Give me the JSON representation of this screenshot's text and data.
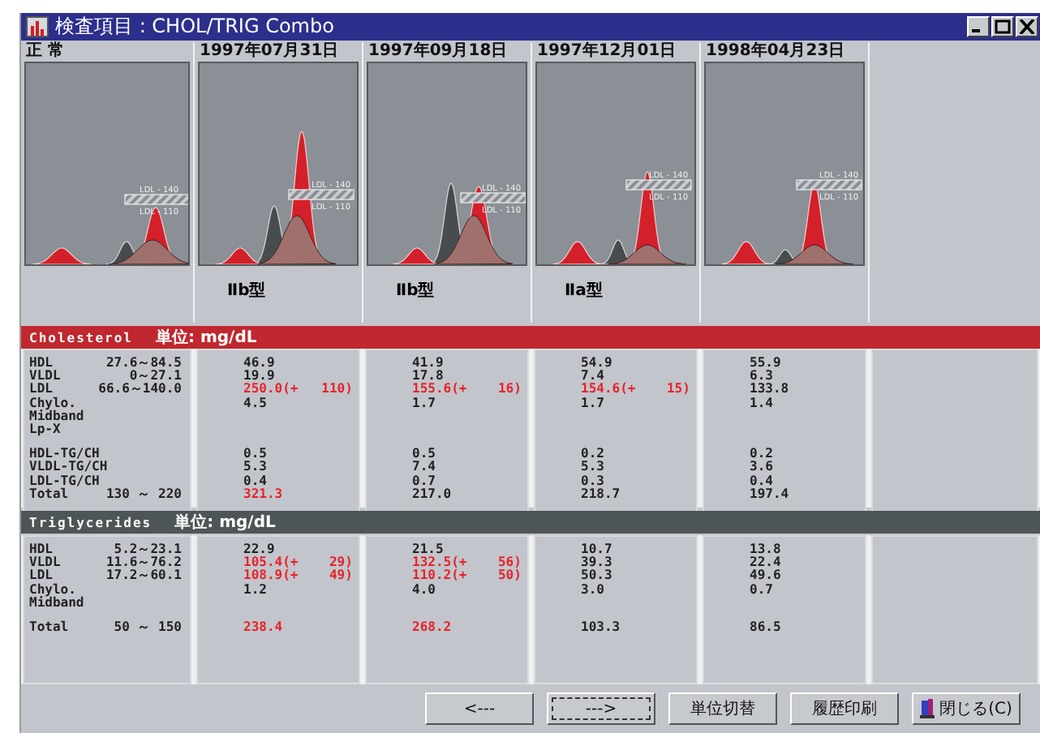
{
  "window": {
    "title": "検査項目 : CHOL/TRIG Combo"
  },
  "columns": [
    {
      "header": "正 常",
      "thresholds": [
        "LDL - 140",
        "LDL - 110"
      ]
    },
    {
      "header": "1997年07月31日",
      "thresholds": [
        "LDL - 140",
        "LDL - 110"
      ],
      "type_label": "Ⅱb型"
    },
    {
      "header": "1997年09月18日",
      "thresholds": [
        "LDL - 140",
        "LDL - 110"
      ],
      "type_label": "Ⅱb型"
    },
    {
      "header": "1997年12月01日",
      "thresholds": [
        "LDL - 140",
        "LDL - 110"
      ],
      "type_label": "Ⅱa型"
    },
    {
      "header": "1998年04月23日",
      "thresholds": [
        "LDL - 140",
        "LDL - 110"
      ]
    }
  ],
  "sections": [
    {
      "kind": "cholesterol",
      "title": "Cholesterol",
      "unit": "単位: mg/dL",
      "groups": [
        [
          {
            "label": "HDL",
            "range": "27.6～84.5",
            "values": [
              {
                "text": "46.9",
                "high": false
              },
              {
                "text": "41.9",
                "high": false
              },
              {
                "text": "54.9",
                "high": false
              },
              {
                "text": "55.9",
                "high": false
              }
            ]
          },
          {
            "label": "VLDL",
            "range": "0～27.1",
            "values": [
              {
                "text": "19.9",
                "high": false
              },
              {
                "text": "17.8",
                "high": false
              },
              {
                "text": "7.4",
                "high": false
              },
              {
                "text": "6.3",
                "high": false
              }
            ]
          },
          {
            "label": "LDL",
            "range": "66.6～140.0",
            "values": [
              {
                "text": "250.0(+   110)",
                "high": true
              },
              {
                "text": "155.6(+    16)",
                "high": true
              },
              {
                "text": "154.6(+    15)",
                "high": true
              },
              {
                "text": "133.8",
                "high": false
              }
            ]
          },
          {
            "label": "Chylo.",
            "values": [
              {
                "text": "4.5",
                "high": false
              },
              {
                "text": "1.7",
                "high": false
              },
              {
                "text": "1.7",
                "high": false
              },
              {
                "text": "1.4",
                "high": false
              }
            ]
          },
          {
            "label": "Midband"
          },
          {
            "label": "Lp-X"
          }
        ],
        [
          {
            "label": "HDL-TG/CH",
            "values": [
              {
                "text": "0.5",
                "high": false
              },
              {
                "text": "0.5",
                "high": false
              },
              {
                "text": "0.2",
                "high": false
              },
              {
                "text": "0.2",
                "high": false
              }
            ]
          },
          {
            "label": "VLDL-TG/CH",
            "values": [
              {
                "text": "5.3",
                "high": false
              },
              {
                "text": "7.4",
                "high": false
              },
              {
                "text": "5.3",
                "high": false
              },
              {
                "text": "3.6",
                "high": false
              }
            ]
          },
          {
            "label": "LDL-TG/CH",
            "values": [
              {
                "text": "0.4",
                "high": false
              },
              {
                "text": "0.7",
                "high": false
              },
              {
                "text": "0.3",
                "high": false
              },
              {
                "text": "0.4",
                "high": false
              }
            ]
          },
          {
            "label": "Total",
            "range": "130 ～ 220",
            "values": [
              {
                "text": "321.3",
                "high": true
              },
              {
                "text": "217.0",
                "high": false
              },
              {
                "text": "218.7",
                "high": false
              },
              {
                "text": "197.4",
                "high": false
              }
            ]
          }
        ]
      ]
    },
    {
      "kind": "triglycerides",
      "title": "Triglycerides",
      "unit": "単位: mg/dL",
      "groups": [
        [
          {
            "label": "HDL",
            "range": "5.2～23.1",
            "values": [
              {
                "text": "22.9",
                "high": false
              },
              {
                "text": "21.5",
                "high": false
              },
              {
                "text": "10.7",
                "high": false
              },
              {
                "text": "13.8",
                "high": false
              }
            ]
          },
          {
            "label": "VLDL",
            "range": "11.6～76.2",
            "values": [
              {
                "text": "105.4(+    29)",
                "high": true
              },
              {
                "text": "132.5(+    56)",
                "high": true
              },
              {
                "text": "39.3",
                "high": false
              },
              {
                "text": "22.4",
                "high": false
              }
            ]
          },
          {
            "label": "LDL",
            "range": "17.2～60.1",
            "values": [
              {
                "text": "108.9(+    49)",
                "high": true
              },
              {
                "text": "110.2(+    50)",
                "high": true
              },
              {
                "text": "50.3",
                "high": false
              },
              {
                "text": "49.6",
                "high": false
              }
            ]
          },
          {
            "label": "Chylo.",
            "values": [
              {
                "text": "1.2",
                "high": false
              },
              {
                "text": "4.0",
                "high": false
              },
              {
                "text": "3.0",
                "high": false
              },
              {
                "text": "0.7",
                "high": false
              }
            ]
          },
          {
            "label": "Midband"
          }
        ],
        [
          {
            "label": "Total",
            "range": "50 ～ 150",
            "values": [
              {
                "text": "238.4",
                "high": true
              },
              {
                "text": "268.2",
                "high": true
              },
              {
                "text": "103.3",
                "high": false
              },
              {
                "text": "86.5",
                "high": false
              }
            ]
          }
        ]
      ]
    }
  ],
  "buttons": [
    {
      "label": "<---",
      "focused": false
    },
    {
      "label": "--->",
      "focused": true
    },
    {
      "label": "単位切替",
      "focused": false
    },
    {
      "label": "履歴印刷",
      "focused": false
    },
    {
      "label": "閉じる(C)",
      "focused": false,
      "has_icon": true
    }
  ]
}
